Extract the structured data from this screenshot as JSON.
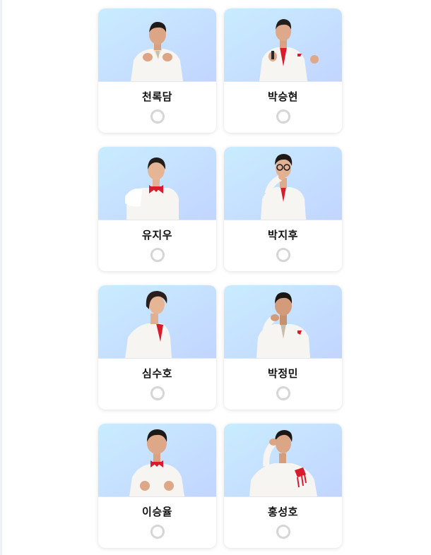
{
  "colors": {
    "photo_bg_top": "#c9ecff",
    "photo_bg_bottom": "#c2d5ff",
    "suit": "#f7f5f1",
    "accent_red": "#d91c2c",
    "radio_border": "#d6d6d6"
  },
  "candidates": [
    {
      "name": "천록담",
      "selected": false,
      "pose": "heart-hands"
    },
    {
      "name": "박승현",
      "selected": false,
      "pose": "microphone"
    },
    {
      "name": "유지우",
      "selected": false,
      "pose": "jacket-over-shoulder"
    },
    {
      "name": "박지후",
      "selected": false,
      "pose": "hand-on-chin-glasses"
    },
    {
      "name": "심수호",
      "selected": false,
      "pose": "side-profile"
    },
    {
      "name": "박정민",
      "selected": false,
      "pose": "hand-on-neck"
    },
    {
      "name": "이승율",
      "selected": false,
      "pose": "heart-hands"
    },
    {
      "name": "홍성호",
      "selected": false,
      "pose": "hand-behind-head"
    }
  ]
}
